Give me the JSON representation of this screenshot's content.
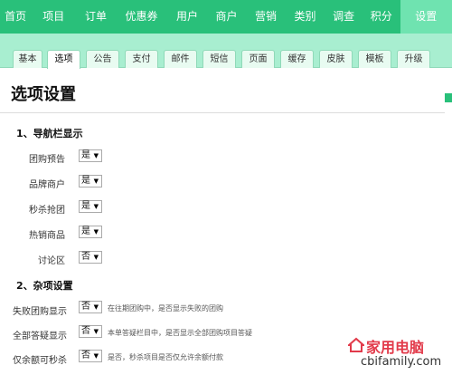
{
  "topnav": {
    "items": [
      "首页",
      "项目",
      "订单",
      "优惠券",
      "用户",
      "商户",
      "营销",
      "类别",
      "调查",
      "积分",
      "设置"
    ],
    "active_index": 10,
    "color": "#29c07a",
    "active_color": "#6fe3b0"
  },
  "tabs": {
    "items": [
      "基本",
      "选项",
      "公告",
      "支付",
      "邮件",
      "短信",
      "页面",
      "缓存",
      "皮肤",
      "模板",
      "升级"
    ],
    "active_index": 1
  },
  "page": {
    "title": "选项设置"
  },
  "sections": [
    {
      "title": "1、导航栏显示",
      "rows": [
        {
          "label": "团购预告",
          "value": "是"
        },
        {
          "label": "品牌商户",
          "value": "是"
        },
        {
          "label": "秒杀抢团",
          "value": "是"
        },
        {
          "label": "热销商品",
          "value": "是"
        },
        {
          "label": "讨论区",
          "value": "否"
        }
      ]
    },
    {
      "title": "2、杂项设置",
      "rows": [
        {
          "label": "失败团购显示",
          "value": "否",
          "hint": "在往期团购中，是否显示失败的团购"
        },
        {
          "label": "全部答疑显示",
          "value": "否",
          "hint": "本单答疑栏目中，是否显示全部团购项目答疑"
        },
        {
          "label": "仅余额可秒杀",
          "value": "否",
          "hint": "是否，秒杀项目是否仅允许余额付款"
        }
      ]
    }
  ],
  "watermark": {
    "title": "家用电脑",
    "url": "cbifamily.com",
    "color": "#e23a4a"
  }
}
